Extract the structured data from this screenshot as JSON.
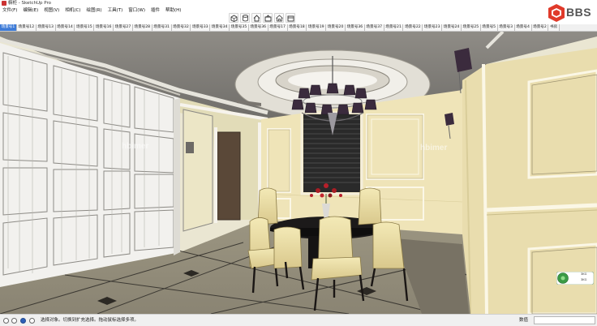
{
  "window": {
    "title": "橱柜 - SketchUp Pro"
  },
  "menu": [
    "文件(F)",
    "编辑(E)",
    "视图(V)",
    "相机(C)",
    "绘图(R)",
    "工具(T)",
    "窗口(W)",
    "插件",
    "帮助(H)"
  ],
  "toolbar": [
    "3d-warehouse-icon",
    "components-icon",
    "home-icon",
    "share-icon",
    "house-icon",
    "layout-icon"
  ],
  "logo": {
    "text": "BBS"
  },
  "scene_tabs": [
    "场景号1",
    "场景号12",
    "场景号13",
    "场景号14",
    "场景号15",
    "场景号16",
    "场景号27",
    "场景号28",
    "场景号31",
    "场景号32",
    "场景号33",
    "场景号34",
    "场景号35",
    "场景号36",
    "场景号17",
    "场景号18",
    "场景号19",
    "场景号20",
    "场景号36",
    "场景号37",
    "场景号21",
    "场景号22",
    "场景号23",
    "场景号24",
    "场景号25",
    "场景号5",
    "场景号3",
    "场景号4",
    "场景号2",
    "书房"
  ],
  "active_tab_index": 0,
  "status": {
    "text": "选择对象。切换到扩充选择。拖动鼠标选择多项。",
    "measure_label": "数值",
    "measure_value": ""
  },
  "watermark": "hbimer",
  "nav_widget": {
    "rows": [
      "3KG",
      "3KG"
    ]
  },
  "colors": {
    "accent_tab": "#3d7bd8",
    "viewport_bg": "#eae6d2"
  }
}
